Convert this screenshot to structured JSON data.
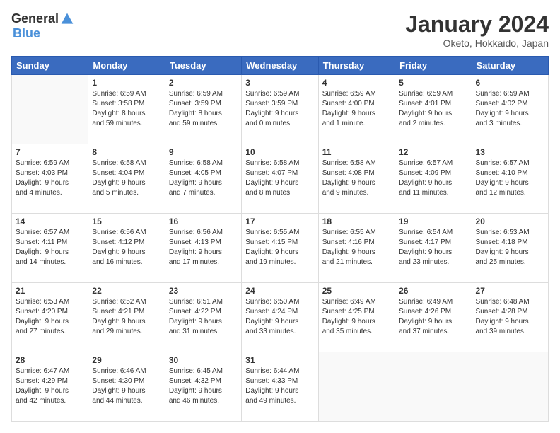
{
  "header": {
    "logo_general": "General",
    "logo_blue": "Blue",
    "main_title": "January 2024",
    "subtitle": "Oketo, Hokkaido, Japan"
  },
  "weekdays": [
    "Sunday",
    "Monday",
    "Tuesday",
    "Wednesday",
    "Thursday",
    "Friday",
    "Saturday"
  ],
  "weeks": [
    [
      {
        "day": "",
        "info": ""
      },
      {
        "day": "1",
        "info": "Sunrise: 6:59 AM\nSunset: 3:58 PM\nDaylight: 8 hours\nand 59 minutes."
      },
      {
        "day": "2",
        "info": "Sunrise: 6:59 AM\nSunset: 3:59 PM\nDaylight: 8 hours\nand 59 minutes."
      },
      {
        "day": "3",
        "info": "Sunrise: 6:59 AM\nSunset: 3:59 PM\nDaylight: 9 hours\nand 0 minutes."
      },
      {
        "day": "4",
        "info": "Sunrise: 6:59 AM\nSunset: 4:00 PM\nDaylight: 9 hours\nand 1 minute."
      },
      {
        "day": "5",
        "info": "Sunrise: 6:59 AM\nSunset: 4:01 PM\nDaylight: 9 hours\nand 2 minutes."
      },
      {
        "day": "6",
        "info": "Sunrise: 6:59 AM\nSunset: 4:02 PM\nDaylight: 9 hours\nand 3 minutes."
      }
    ],
    [
      {
        "day": "7",
        "info": "Sunrise: 6:59 AM\nSunset: 4:03 PM\nDaylight: 9 hours\nand 4 minutes."
      },
      {
        "day": "8",
        "info": "Sunrise: 6:58 AM\nSunset: 4:04 PM\nDaylight: 9 hours\nand 5 minutes."
      },
      {
        "day": "9",
        "info": "Sunrise: 6:58 AM\nSunset: 4:05 PM\nDaylight: 9 hours\nand 7 minutes."
      },
      {
        "day": "10",
        "info": "Sunrise: 6:58 AM\nSunset: 4:07 PM\nDaylight: 9 hours\nand 8 minutes."
      },
      {
        "day": "11",
        "info": "Sunrise: 6:58 AM\nSunset: 4:08 PM\nDaylight: 9 hours\nand 9 minutes."
      },
      {
        "day": "12",
        "info": "Sunrise: 6:57 AM\nSunset: 4:09 PM\nDaylight: 9 hours\nand 11 minutes."
      },
      {
        "day": "13",
        "info": "Sunrise: 6:57 AM\nSunset: 4:10 PM\nDaylight: 9 hours\nand 12 minutes."
      }
    ],
    [
      {
        "day": "14",
        "info": "Sunrise: 6:57 AM\nSunset: 4:11 PM\nDaylight: 9 hours\nand 14 minutes."
      },
      {
        "day": "15",
        "info": "Sunrise: 6:56 AM\nSunset: 4:12 PM\nDaylight: 9 hours\nand 16 minutes."
      },
      {
        "day": "16",
        "info": "Sunrise: 6:56 AM\nSunset: 4:13 PM\nDaylight: 9 hours\nand 17 minutes."
      },
      {
        "day": "17",
        "info": "Sunrise: 6:55 AM\nSunset: 4:15 PM\nDaylight: 9 hours\nand 19 minutes."
      },
      {
        "day": "18",
        "info": "Sunrise: 6:55 AM\nSunset: 4:16 PM\nDaylight: 9 hours\nand 21 minutes."
      },
      {
        "day": "19",
        "info": "Sunrise: 6:54 AM\nSunset: 4:17 PM\nDaylight: 9 hours\nand 23 minutes."
      },
      {
        "day": "20",
        "info": "Sunrise: 6:53 AM\nSunset: 4:18 PM\nDaylight: 9 hours\nand 25 minutes."
      }
    ],
    [
      {
        "day": "21",
        "info": "Sunrise: 6:53 AM\nSunset: 4:20 PM\nDaylight: 9 hours\nand 27 minutes."
      },
      {
        "day": "22",
        "info": "Sunrise: 6:52 AM\nSunset: 4:21 PM\nDaylight: 9 hours\nand 29 minutes."
      },
      {
        "day": "23",
        "info": "Sunrise: 6:51 AM\nSunset: 4:22 PM\nDaylight: 9 hours\nand 31 minutes."
      },
      {
        "day": "24",
        "info": "Sunrise: 6:50 AM\nSunset: 4:24 PM\nDaylight: 9 hours\nand 33 minutes."
      },
      {
        "day": "25",
        "info": "Sunrise: 6:49 AM\nSunset: 4:25 PM\nDaylight: 9 hours\nand 35 minutes."
      },
      {
        "day": "26",
        "info": "Sunrise: 6:49 AM\nSunset: 4:26 PM\nDaylight: 9 hours\nand 37 minutes."
      },
      {
        "day": "27",
        "info": "Sunrise: 6:48 AM\nSunset: 4:28 PM\nDaylight: 9 hours\nand 39 minutes."
      }
    ],
    [
      {
        "day": "28",
        "info": "Sunrise: 6:47 AM\nSunset: 4:29 PM\nDaylight: 9 hours\nand 42 minutes."
      },
      {
        "day": "29",
        "info": "Sunrise: 6:46 AM\nSunset: 4:30 PM\nDaylight: 9 hours\nand 44 minutes."
      },
      {
        "day": "30",
        "info": "Sunrise: 6:45 AM\nSunset: 4:32 PM\nDaylight: 9 hours\nand 46 minutes."
      },
      {
        "day": "31",
        "info": "Sunrise: 6:44 AM\nSunset: 4:33 PM\nDaylight: 9 hours\nand 49 minutes."
      },
      {
        "day": "",
        "info": ""
      },
      {
        "day": "",
        "info": ""
      },
      {
        "day": "",
        "info": ""
      }
    ]
  ]
}
